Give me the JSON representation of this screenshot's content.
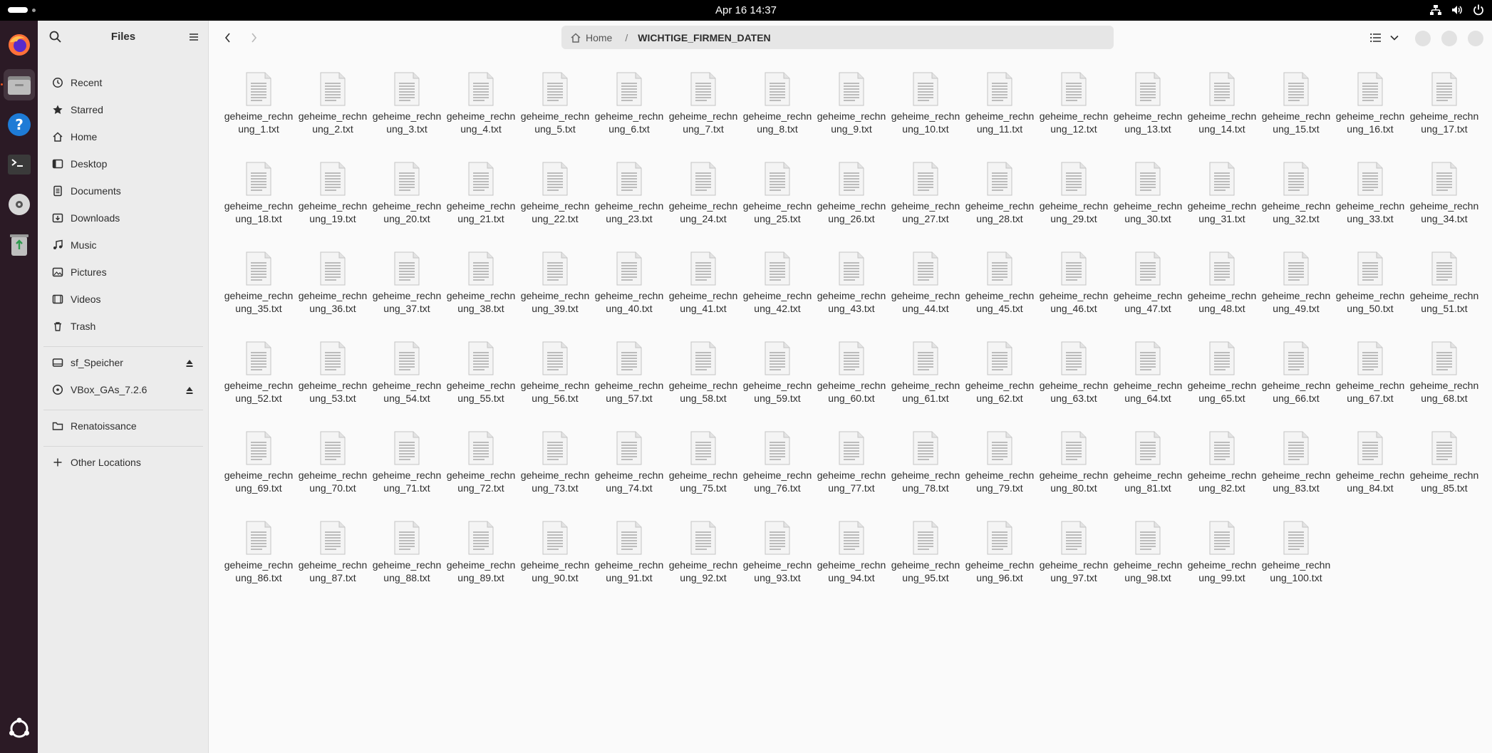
{
  "topbar": {
    "clock": "Apr 16  14:37",
    "tray_icons": [
      "network-icon",
      "volume-icon",
      "power-icon"
    ]
  },
  "dock": {
    "apps": [
      "firefox",
      "files",
      "help",
      "terminal",
      "optical-disc",
      "trash"
    ],
    "show_apps_icon": "ubuntu-apps-icon"
  },
  "sidebar": {
    "title": "Files",
    "places": [
      {
        "label": "Recent",
        "icon": "clock-icon"
      },
      {
        "label": "Starred",
        "icon": "star-icon"
      },
      {
        "label": "Home",
        "icon": "home-icon"
      },
      {
        "label": "Desktop",
        "icon": "desktop-icon"
      },
      {
        "label": "Documents",
        "icon": "document-icon"
      },
      {
        "label": "Downloads",
        "icon": "download-icon"
      },
      {
        "label": "Music",
        "icon": "music-icon"
      },
      {
        "label": "Pictures",
        "icon": "picture-icon"
      },
      {
        "label": "Videos",
        "icon": "video-icon"
      },
      {
        "label": "Trash",
        "icon": "trash-icon"
      }
    ],
    "devices": [
      {
        "label": "sf_Speicher",
        "icon": "drive-icon"
      },
      {
        "label": "VBox_GAs_7.2.6",
        "icon": "disc-icon"
      }
    ],
    "bookmarks": [
      {
        "label": "Renatoissance",
        "icon": "folder-icon"
      }
    ],
    "other_locations": "Other Locations"
  },
  "header": {
    "path_home": "Home",
    "path_separator": "/",
    "path_current": "WICHTIGE_FIRMEN_DATEN"
  },
  "files": {
    "items": [
      "geheime_rechnung_1.txt",
      "geheime_rechnung_2.txt",
      "geheime_rechnung_3.txt",
      "geheime_rechnung_4.txt",
      "geheime_rechnung_5.txt",
      "geheime_rechnung_6.txt",
      "geheime_rechnung_7.txt",
      "geheime_rechnung_8.txt",
      "geheime_rechnung_9.txt",
      "geheime_rechnung_10.txt",
      "geheime_rechnung_11.txt",
      "geheime_rechnung_12.txt",
      "geheime_rechnung_13.txt",
      "geheime_rechnung_14.txt",
      "geheime_rechnung_15.txt",
      "geheime_rechnung_16.txt",
      "geheime_rechnung_17.txt",
      "geheime_rechnung_18.txt",
      "geheime_rechnung_19.txt",
      "geheime_rechnung_20.txt",
      "geheime_rechnung_21.txt",
      "geheime_rechnung_22.txt",
      "geheime_rechnung_23.txt",
      "geheime_rechnung_24.txt",
      "geheime_rechnung_25.txt",
      "geheime_rechnung_26.txt",
      "geheime_rechnung_27.txt",
      "geheime_rechnung_28.txt",
      "geheime_rechnung_29.txt",
      "geheime_rechnung_30.txt",
      "geheime_rechnung_31.txt",
      "geheime_rechnung_32.txt",
      "geheime_rechnung_33.txt",
      "geheime_rechnung_34.txt",
      "geheime_rechnung_35.txt",
      "geheime_rechnung_36.txt",
      "geheime_rechnung_37.txt",
      "geheime_rechnung_38.txt",
      "geheime_rechnung_39.txt",
      "geheime_rechnung_40.txt",
      "geheime_rechnung_41.txt",
      "geheime_rechnung_42.txt",
      "geheime_rechnung_43.txt",
      "geheime_rechnung_44.txt",
      "geheime_rechnung_45.txt",
      "geheime_rechnung_46.txt",
      "geheime_rechnung_47.txt",
      "geheime_rechnung_48.txt",
      "geheime_rechnung_49.txt",
      "geheime_rechnung_50.txt",
      "geheime_rechnung_51.txt",
      "geheime_rechnung_52.txt",
      "geheime_rechnung_53.txt",
      "geheime_rechnung_54.txt",
      "geheime_rechnung_55.txt",
      "geheime_rechnung_56.txt",
      "geheime_rechnung_57.txt",
      "geheime_rechnung_58.txt",
      "geheime_rechnung_59.txt",
      "geheime_rechnung_60.txt",
      "geheime_rechnung_61.txt",
      "geheime_rechnung_62.txt",
      "geheime_rechnung_63.txt",
      "geheime_rechnung_64.txt",
      "geheime_rechnung_65.txt",
      "geheime_rechnung_66.txt",
      "geheime_rechnung_67.txt",
      "geheime_rechnung_68.txt",
      "geheime_rechnung_69.txt",
      "geheime_rechnung_70.txt",
      "geheime_rechnung_71.txt",
      "geheime_rechnung_72.txt",
      "geheime_rechnung_73.txt",
      "geheime_rechnung_74.txt",
      "geheime_rechnung_75.txt",
      "geheime_rechnung_76.txt",
      "geheime_rechnung_77.txt",
      "geheime_rechnung_78.txt",
      "geheime_rechnung_79.txt",
      "geheime_rechnung_80.txt",
      "geheime_rechnung_81.txt",
      "geheime_rechnung_82.txt",
      "geheime_rechnung_83.txt",
      "geheime_rechnung_84.txt",
      "geheime_rechnung_85.txt",
      "geheime_rechnung_86.txt",
      "geheime_rechnung_87.txt",
      "geheime_rechnung_88.txt",
      "geheime_rechnung_89.txt",
      "geheime_rechnung_90.txt",
      "geheime_rechnung_91.txt",
      "geheime_rechnung_92.txt",
      "geheime_rechnung_93.txt",
      "geheime_rechnung_94.txt",
      "geheime_rechnung_95.txt",
      "geheime_rechnung_96.txt",
      "geheime_rechnung_97.txt",
      "geheime_rechnung_98.txt",
      "geheime_rechnung_99.txt",
      "geheime_rechnung_100.txt"
    ]
  },
  "colors": {
    "topbar": "#000000",
    "dock": "#2b1a25",
    "sidebar": "#ececec",
    "content": "#fafafa",
    "accent": "#e95420"
  }
}
